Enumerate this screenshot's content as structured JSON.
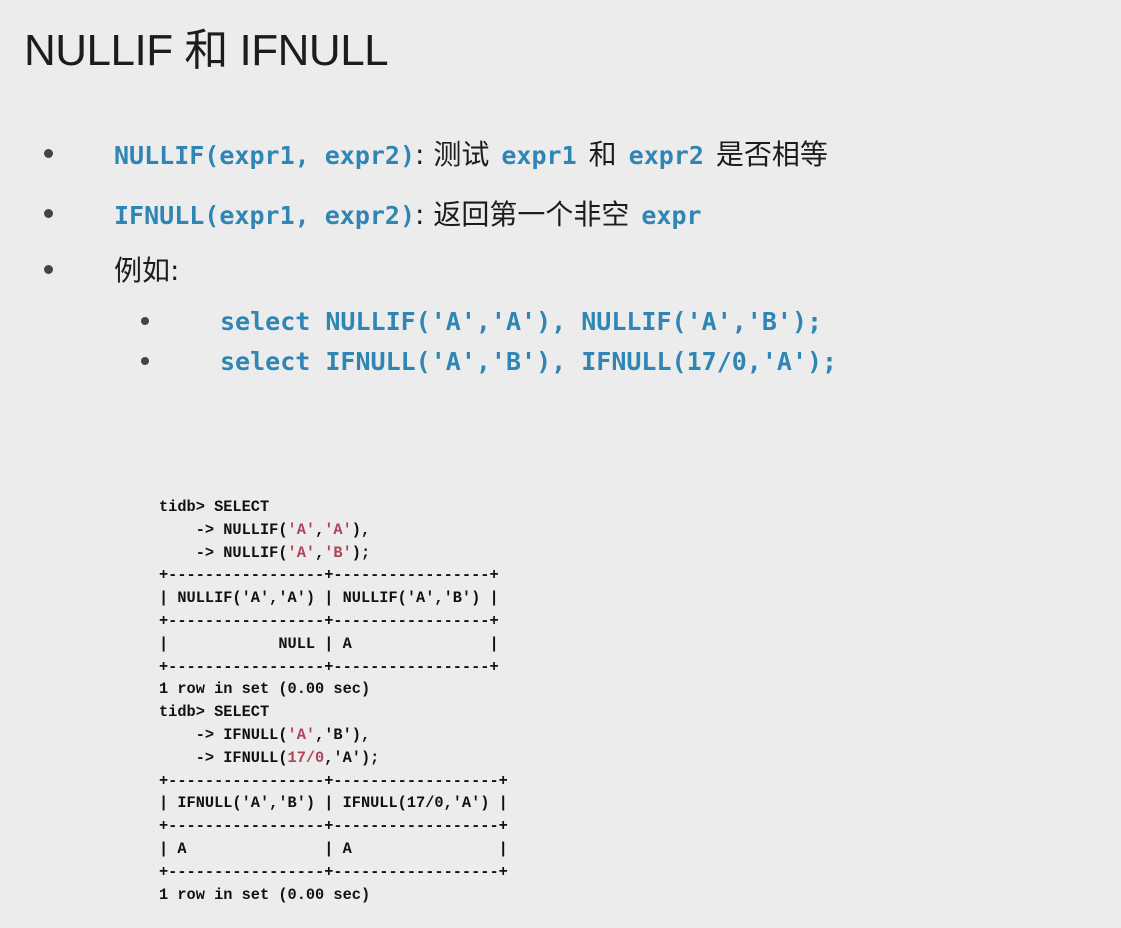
{
  "title": "NULLIF 和 IFNULL",
  "bullets": [
    {
      "code": "NULLIF(expr1, expr2)",
      "text_a": ": 测试",
      "code_b": "expr1",
      "text_b": "和",
      "code_c": "expr2",
      "text_c": "是否相等"
    },
    {
      "code": "IFNULL(expr1, expr2)",
      "text_a": ": 返回第一个非空",
      "code_b": "expr"
    },
    {
      "text_a": "例如:"
    }
  ],
  "sub_bullets": [
    "select NULLIF('A','A'), NULLIF('A','B');",
    "select IFNULL('A','B'), IFNULL(17/0,'A');"
  ],
  "terminal": {
    "q1_line1": "tidb> SELECT",
    "q1_line2": "    -> NULLIF('A','A'),",
    "q1_line3": "    -> NULLIF('A','B');",
    "sep1": "+-----------------+-----------------+",
    "header1": "| NULLIF('A','A') | NULLIF('A','B') |",
    "row1": "|            NULL | A               |",
    "result1": "1 row in set (0.00 sec)",
    "q2_line1": "tidb> SELECT",
    "q2_line2": "    -> IFNULL('A','B'),",
    "q2_line3": "    -> IFNULL(17/0,'A');",
    "sep2": "+-----------------+------------------+",
    "header2": "| IFNULL('A','B') | IFNULL(17/0,'A') |",
    "row2": "| A               | A                |",
    "result2": "1 row in set (0.00 sec)"
  }
}
